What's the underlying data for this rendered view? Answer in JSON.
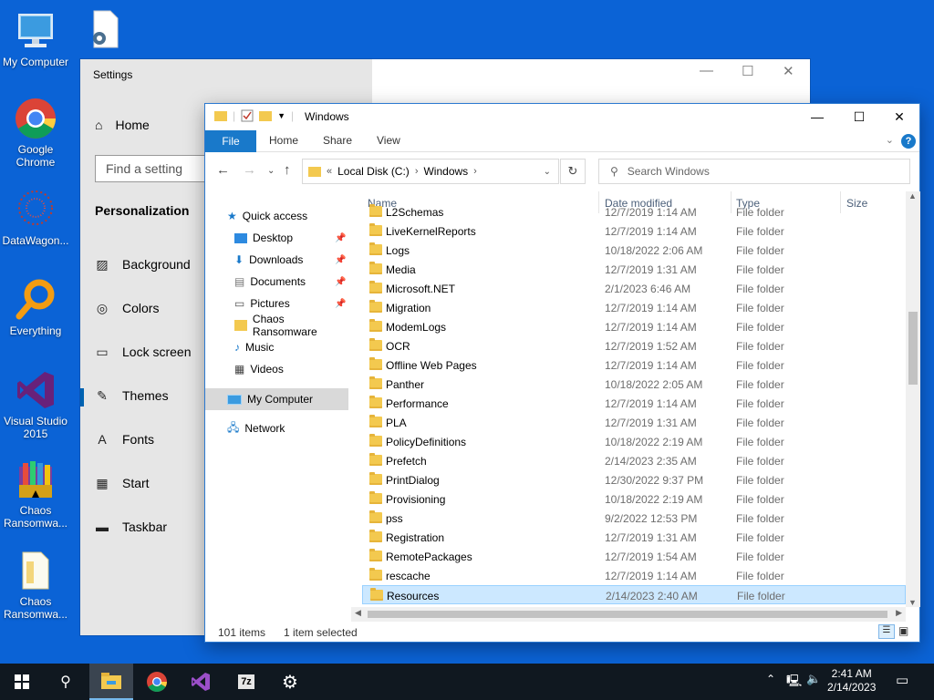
{
  "desktop": {
    "icons": [
      {
        "label": "My Computer",
        "icon": "monitor-icon"
      },
      {
        "label": "",
        "icon": "gear-document-icon"
      },
      {
        "label": "Google Chrome",
        "icon": "chrome-icon"
      },
      {
        "label": "DataWagon...",
        "icon": "datawagon-icon"
      },
      {
        "label": "Everything",
        "icon": "search-magnifier-icon"
      },
      {
        "label": "Visual Studio 2015",
        "icon": "visual-studio-icon"
      },
      {
        "label": "Chaos Ransomwa...",
        "icon": "archive-icon"
      },
      {
        "label": "Chaos Ransomwa...",
        "icon": "document-icon"
      }
    ]
  },
  "settings": {
    "title": "Settings",
    "home": "Home",
    "search_placeholder": "Find a setting",
    "section": "Personalization",
    "nav": [
      "Background",
      "Colors",
      "Lock screen",
      "Themes",
      "Fonts",
      "Start",
      "Taskbar"
    ]
  },
  "explorer": {
    "title": "Windows",
    "ribbon": {
      "file": "File",
      "home": "Home",
      "share": "Share",
      "view": "View"
    },
    "address": {
      "prefix": "«",
      "parts": [
        "Local Disk (C:)",
        "Windows"
      ]
    },
    "search_placeholder": "Search Windows",
    "columns": {
      "name": "Name",
      "date": "Date modified",
      "type": "Type",
      "size": "Size"
    },
    "nav": {
      "quick_access": "Quick access",
      "items": [
        "Desktop",
        "Downloads",
        "Documents",
        "Pictures",
        "Chaos Ransomware",
        "Music",
        "Videos"
      ],
      "this_pc": "My Computer",
      "network": "Network"
    },
    "files": [
      {
        "name": "L2Schemas",
        "date": "12/7/2019 1:14 AM",
        "type": "File folder"
      },
      {
        "name": "LiveKernelReports",
        "date": "12/7/2019 1:14 AM",
        "type": "File folder"
      },
      {
        "name": "Logs",
        "date": "10/18/2022 2:06 AM",
        "type": "File folder"
      },
      {
        "name": "Media",
        "date": "12/7/2019 1:31 AM",
        "type": "File folder"
      },
      {
        "name": "Microsoft.NET",
        "date": "2/1/2023 6:46 AM",
        "type": "File folder"
      },
      {
        "name": "Migration",
        "date": "12/7/2019 1:14 AM",
        "type": "File folder"
      },
      {
        "name": "ModemLogs",
        "date": "12/7/2019 1:14 AM",
        "type": "File folder"
      },
      {
        "name": "OCR",
        "date": "12/7/2019 1:52 AM",
        "type": "File folder"
      },
      {
        "name": "Offline Web Pages",
        "date": "12/7/2019 1:14 AM",
        "type": "File folder"
      },
      {
        "name": "Panther",
        "date": "10/18/2022 2:05 AM",
        "type": "File folder"
      },
      {
        "name": "Performance",
        "date": "12/7/2019 1:14 AM",
        "type": "File folder"
      },
      {
        "name": "PLA",
        "date": "12/7/2019 1:31 AM",
        "type": "File folder"
      },
      {
        "name": "PolicyDefinitions",
        "date": "10/18/2022 2:19 AM",
        "type": "File folder"
      },
      {
        "name": "Prefetch",
        "date": "2/14/2023 2:35 AM",
        "type": "File folder"
      },
      {
        "name": "PrintDialog",
        "date": "12/30/2022 9:37 PM",
        "type": "File folder"
      },
      {
        "name": "Provisioning",
        "date": "10/18/2022 2:19 AM",
        "type": "File folder"
      },
      {
        "name": "pss",
        "date": "9/2/2022 12:53 PM",
        "type": "File folder"
      },
      {
        "name": "Registration",
        "date": "12/7/2019 1:31 AM",
        "type": "File folder"
      },
      {
        "name": "RemotePackages",
        "date": "12/7/2019 1:54 AM",
        "type": "File folder"
      },
      {
        "name": "rescache",
        "date": "12/7/2019 1:14 AM",
        "type": "File folder"
      },
      {
        "name": "Resources",
        "date": "2/14/2023 2:40 AM",
        "type": "File folder",
        "selected": true
      }
    ],
    "status": {
      "count": "101 items",
      "selected": "1 item selected"
    }
  },
  "taskbar": {
    "time": "2:41 AM",
    "date": "2/14/2023",
    "apps": [
      "file-explorer-icon",
      "chrome-icon",
      "visual-studio-icon",
      "7zip-icon",
      "settings-gear-icon"
    ]
  }
}
